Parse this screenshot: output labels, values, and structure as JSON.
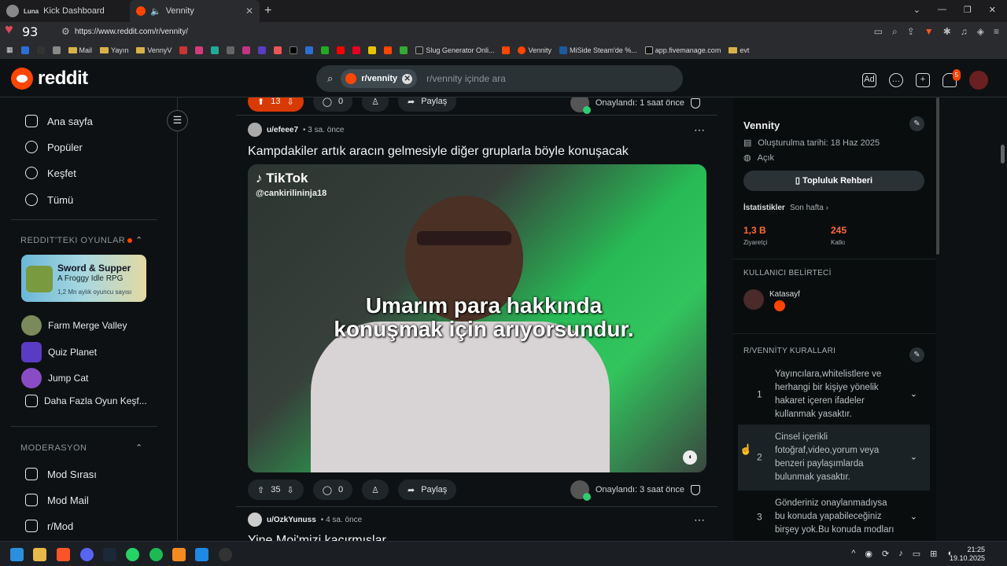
{
  "browser": {
    "tabs": [
      {
        "label": "Luna",
        "sub": "Kick Dashboard"
      },
      {
        "label": "Vennity"
      }
    ],
    "heart_value": "93",
    "url": "https://www.reddit.com/r/vennity/",
    "bookmarks": [
      "Mail",
      "Yayın",
      "VennyV",
      "Slug Generator Onli...",
      "Vennity",
      "MiSide Steam'de %...",
      "app.fivemanage.com",
      "evt"
    ]
  },
  "header": {
    "logo": "reddit",
    "search_chip": "r/vennity",
    "search_placeholder": "r/vennity içinde ara",
    "notification_count": "5"
  },
  "sidebar": {
    "nav": [
      {
        "label": "Ana sayfa",
        "icon": "home-icon"
      },
      {
        "label": "Popüler",
        "icon": "popular-icon"
      },
      {
        "label": "Keşfet",
        "icon": "explore-icon"
      },
      {
        "label": "Tümü",
        "icon": "all-icon"
      }
    ],
    "games_heading": "REDDIT'TEKI OYUNLAR",
    "promo": {
      "title": "Sword & Supper",
      "subtitle": "A Froggy Idle RPG",
      "users": "1,2 Mn aylık oyuncu sayısı"
    },
    "games": [
      "Farm Merge Valley",
      "Quiz Planet",
      "Jump Cat",
      "Daha Fazla Oyun Keşf..."
    ],
    "mod_heading": "MODERASYON",
    "mod_items": [
      "Mod Sırası",
      "Mod Mail",
      "r/Mod"
    ]
  },
  "feed": {
    "prev_post": {
      "votes": "13",
      "comments": "0",
      "share": "Paylaş",
      "approved": "Onaylandı: 1 saat önce"
    },
    "post": {
      "user": "u/efeee7",
      "time": "• 3 sa. önce",
      "title": "Kampdakiler artık aracın gelmesiyle diğer gruplarla böyle konuşacak",
      "tiktok": "TikTok",
      "handle": "@cankirilininja18",
      "caption": "Umarım para hakkında konuşmak için arıyorsundur.",
      "votes": "35",
      "comments": "0",
      "share": "Paylaş",
      "approved": "Onaylandı: 3 saat önce"
    },
    "next_post": {
      "user": "u/OzkYunuss",
      "time": "• 4 sa. önce",
      "title": "Yine Moi'mizi kaçırmışlar"
    }
  },
  "community": {
    "name": "Vennity",
    "created": "Oluşturulma tarihi: 18 Haz 2025",
    "status": "Açık",
    "guide_button": "Topluluk Rehberi",
    "stats_heading": "İstatistikler",
    "stats_period": "Son hafta ›",
    "visitors": "1,3 B",
    "visitors_label": "Ziyaretçi",
    "contributions": "245",
    "contributions_label": "Katkı",
    "flair_heading": "KULLANICI BELİRTECİ",
    "flair_user": "Katasayf",
    "rules_heading": "R/VENNİTY KURALLARI",
    "rules": [
      {
        "n": "1",
        "text": "Yayıncılara,whitelistlere ve herhangi bir kişiye yönelik hakaret içeren ifadeler kullanmak yasaktır."
      },
      {
        "n": "2",
        "text": "Cinsel içerikli fotoğraf,video,yorum veya benzeri paylaşımlarda bulunmak yasaktır."
      },
      {
        "n": "3",
        "text": "Gönderiniz onaylanmadıysa bu konuda yapabileceğiniz birşey yok.Bu konuda modları"
      }
    ]
  },
  "taskbar": {
    "time": "21:25",
    "date": "19.10.2025"
  }
}
